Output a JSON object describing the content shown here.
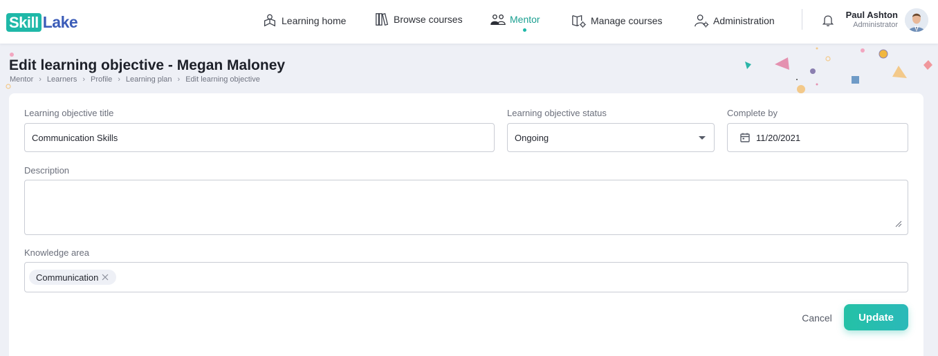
{
  "brand": {
    "logo_part1": "Skill",
    "logo_part2": "Lake"
  },
  "nav": {
    "items": [
      {
        "label": "Learning home",
        "icon": "learning-home-icon"
      },
      {
        "label": "Browse courses",
        "icon": "books-icon"
      },
      {
        "label": "Mentor",
        "icon": "mentor-icon",
        "active": true
      },
      {
        "label": "Manage courses",
        "icon": "manage-courses-icon"
      },
      {
        "label": "Administration",
        "icon": "admin-user-icon"
      }
    ],
    "accent_color": "#1fb8a8"
  },
  "user": {
    "name": "Paul Ashton",
    "role": "Administrator"
  },
  "page": {
    "title": "Edit learning objective - Megan Maloney",
    "breadcrumb": [
      "Mentor",
      "Learners",
      "Profile",
      "Learning plan",
      "Edit learning objective"
    ]
  },
  "form": {
    "title_label": "Learning objective title",
    "title_value": "Communication Skills",
    "status_label": "Learning objective status",
    "status_value": "Ongoing",
    "complete_label": "Complete by",
    "complete_value": "11/20/2021",
    "description_label": "Description",
    "description_value": "",
    "knowledge_label": "Knowledge area",
    "knowledge_tags": [
      "Communication"
    ]
  },
  "actions": {
    "cancel_label": "Cancel",
    "update_label": "Update",
    "update_color": "#24c1a6"
  }
}
